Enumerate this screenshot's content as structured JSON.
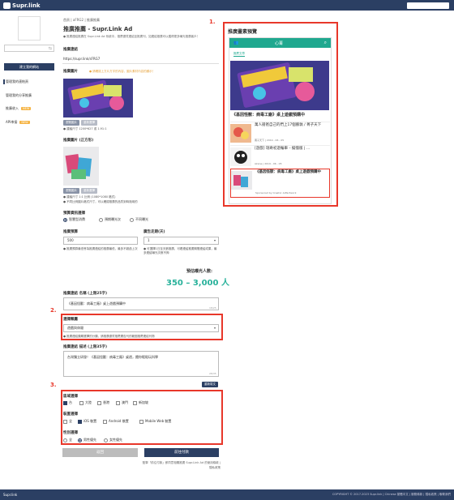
{
  "app": {
    "name": "Supr.link"
  },
  "sidebar": {
    "input_value": "",
    "create_button": "建立我的網站",
    "items": [
      {
        "label": "管理我的連結頁"
      },
      {
        "label": "管理我的分享推廣"
      },
      {
        "label": "推廣收入",
        "badge": "NEW"
      },
      {
        "label": "API串接",
        "badge": "NEW"
      }
    ]
  },
  "breadcrumb": {
    "home": "首頁",
    "mid": "aFRG2",
    "current": "推廣推薦"
  },
  "page": {
    "title": "推廣推薦 - Supr.Link Ad",
    "description": "● 推廣連結推廣在 Supr.Link Ad 系統中，推薦優質連結至推廣刊，如連結推廣可以獲得更多曝光推廣客戶！"
  },
  "form": {
    "link_label": "推廣連結",
    "link_value": "https://supr.link/sFRG7",
    "image_label": "推廣圖片",
    "image_warning": "● 請確認上方片方字的內容，圖片素材內容的顯示！",
    "image_upload": "瀏覽圖片",
    "image_edit": "重新選擇",
    "image_note1": "● 建議尺寸 1200*627 或 1.91:1",
    "image_label2": "推廣圖片 (正方形)",
    "image_note2a": "● 建議尺寸 1:1 比例 (1080*1080 格式)",
    "image_note2b": "● 不同比例圖片格式尺寸，可以確認推廣的品質到時適用的",
    "budget_type_label": "預算資訊選擇",
    "budget_types": [
      {
        "label": "智慧型消費",
        "selected": true
      },
      {
        "label": "預期曝光次",
        "selected": false
      },
      {
        "label": "不同曝光",
        "selected": false
      }
    ],
    "budget_label": "推廣預算",
    "budget_value": "500",
    "budget_note": "● 推廣預算最低會為推廣連結的推廣最低，最多不超過上次",
    "days_label": "廣告走期(天)",
    "days_value": "1",
    "days_note": "● 可選擇1日至天數推廣，可看連結推廣期間連結成果，最多連結曝光次數不夠",
    "estimate_label": "預估曝光人數:",
    "estimate_value": "350 – 3,000 人",
    "title_label": "推廣連結 名稱 (上限25字)",
    "title_value": "《基因怪獸：病毒工廠》桌上遊戲預購中",
    "title_count": "18/25",
    "category_label": "選擇類屬",
    "category_value": "遊戲與休閒",
    "category_note": "● 推廣連結類屬選擇的分類，請推廣優質推薦廣告刊的範圍推薦連結刊物",
    "desc_label": "推廣連結 描述 (上限35字)",
    "desc_value": "台灣獨立研發！《基因怪獸：病毒工廠》桌遊，餵你輕鬆玩科學",
    "desc_count": "28/35",
    "desc_button": "重新寫文",
    "region_label": "區域選擇",
    "regions": [
      {
        "label": "台",
        "checked": true
      },
      {
        "label": "大陸",
        "checked": false
      },
      {
        "label": "香港",
        "checked": false
      },
      {
        "label": "澳門",
        "checked": false
      },
      {
        "label": "新加坡",
        "checked": false
      }
    ],
    "device_label": "裝置選擇",
    "devices": [
      {
        "label": "全",
        "checked": false
      },
      {
        "label": "iOS 裝置",
        "checked": true
      },
      {
        "label": "Android 裝置",
        "checked": false
      },
      {
        "label": "Mobile Web 裝置",
        "checked": false
      }
    ],
    "gender_label": "性別選擇",
    "genders": [
      {
        "label": "全",
        "selected": false
      },
      {
        "label": "男性優先",
        "selected": true
      },
      {
        "label": "女性優先",
        "selected": false
      }
    ],
    "back_button": "返回",
    "save_button": "前往付款",
    "terms": "點擊「前往付款」即同意相關推廣 Supr.Link Ad 的使用條款 | 隱私政策"
  },
  "preview": {
    "title": "推廣畫素預覽",
    "site_name": "心菁",
    "tab": "推薦文章",
    "featured_title": "《基因怪獸：病毒工廠》桌上遊戲預購中",
    "feed": [
      {
        "title": "萬人搶爸自己的們上17個臉孰 / 菁子天下",
        "meta": "菁子天下 | 2019 - 06 - 05"
      },
      {
        "title": "[遊戲] 瑞奇初遊輪車 – 擬憶版 | ...",
        "meta": "Akane | 2019 - 06 - 05"
      },
      {
        "title": "《基因怪獸：病毒工廠》桌上遊戲預購中",
        "meta": "Sponsored by Creator Adfactwork"
      }
    ]
  },
  "annotations": [
    "1.",
    "2.",
    "3."
  ],
  "footer": {
    "left": "Supr.link",
    "right": "COPYRIGHT © 2017-2023 Supr.link  |  Chinese 繁體中文  |  服務條款  |  隱私政策  |  聯繫我們"
  },
  "colors": {
    "navy": "#2b3f63",
    "teal": "#1fa88f",
    "red": "#e8372a",
    "green_text": "#27b19a"
  }
}
